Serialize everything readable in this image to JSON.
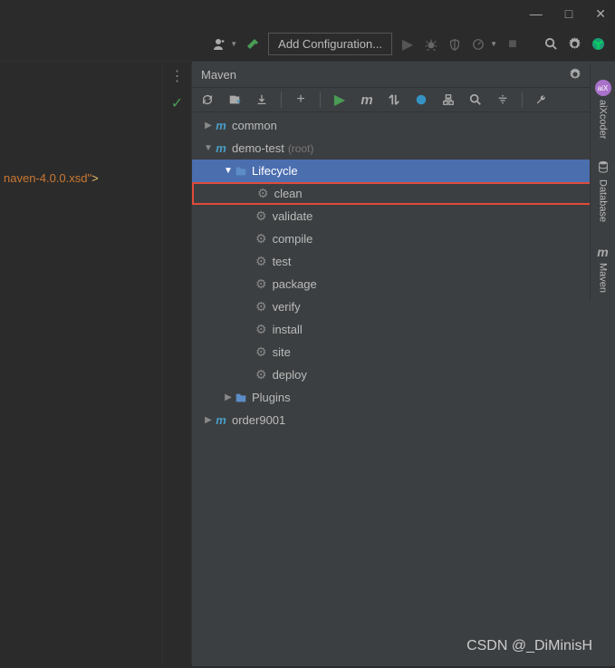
{
  "titlebar": {
    "min": "—",
    "max": "□",
    "close": "✕"
  },
  "toolbar": {
    "add_config": "Add Configuration..."
  },
  "editor": {
    "line_fragment": "naven-4.0.0.xsd\">",
    "xsd": "naven-4.0.0.xsd\"",
    "close": ">"
  },
  "maven": {
    "title": "Maven",
    "projects": {
      "common": "common",
      "demo_test": "demo-test",
      "root": "(root)",
      "lifecycle": "Lifecycle",
      "goals": {
        "clean": "clean",
        "validate": "validate",
        "compile": "compile",
        "test": "test",
        "package": "package",
        "verify": "verify",
        "install": "install",
        "site": "site",
        "deploy": "deploy"
      },
      "plugins": "Plugins",
      "order9001": "order9001"
    }
  },
  "rail": {
    "aixcoder": "aiXcoder",
    "database": "Database",
    "maven": "Maven"
  },
  "watermark": "CSDN @_DiMinisH"
}
